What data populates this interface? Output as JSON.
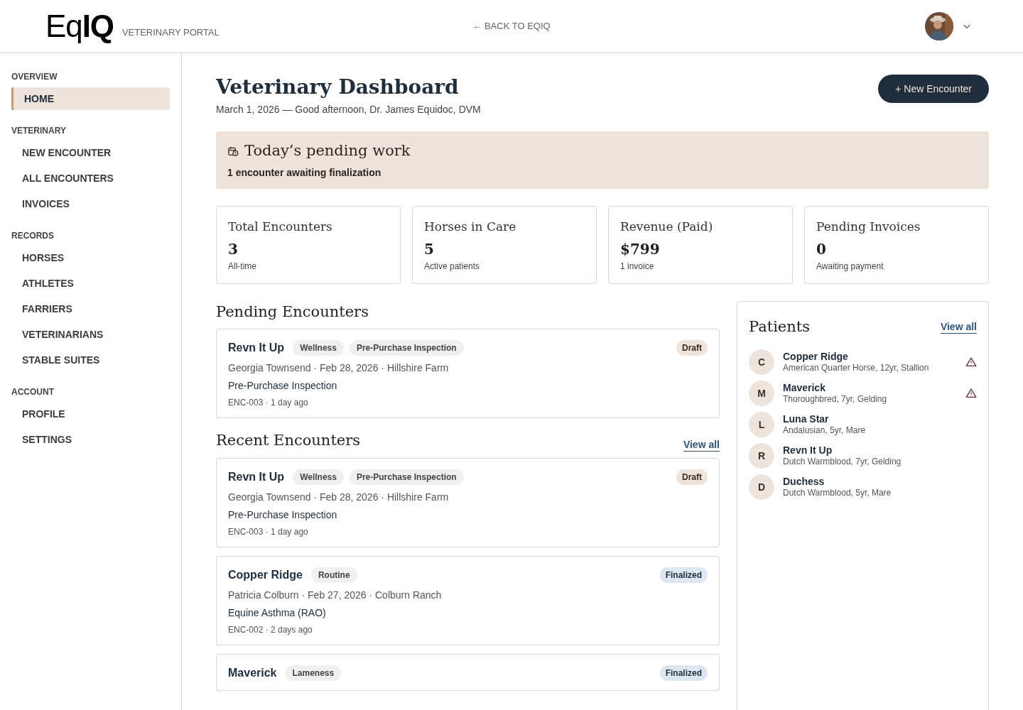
{
  "header": {
    "logo_light": "Eq",
    "logo_bold": "IQ",
    "portal": "VETERINARY PORTAL",
    "back_link": "← BACK TO EQIQ"
  },
  "sidebar": {
    "sections": [
      {
        "title": "OVERVIEW",
        "items": [
          {
            "label": "HOME",
            "selected": true
          }
        ]
      },
      {
        "title": "VETERINARY",
        "items": [
          {
            "label": "NEW ENCOUNTER",
            "selected": false
          },
          {
            "label": "ALL ENCOUNTERS",
            "selected": false
          },
          {
            "label": "INVOICES",
            "selected": false
          }
        ]
      },
      {
        "title": "RECORDS",
        "items": [
          {
            "label": "HORSES",
            "selected": false
          },
          {
            "label": "ATHLETES",
            "selected": false
          },
          {
            "label": "FARRIERS",
            "selected": false
          },
          {
            "label": "VETERINARIANS",
            "selected": false
          },
          {
            "label": "STABLE SUITES",
            "selected": false
          }
        ]
      },
      {
        "title": "ACCOUNT",
        "items": [
          {
            "label": "PROFILE",
            "selected": false
          },
          {
            "label": "SETTINGS",
            "selected": false
          }
        ]
      }
    ]
  },
  "page": {
    "title": "Veterinary Dashboard",
    "subtitle": "March 1, 2026 — Good afternoon, Dr. James Equidoc, DVM",
    "new_button": "+ New Encounter"
  },
  "pending_banner": {
    "title": "Today’s pending work",
    "text": "1 encounter awaiting finalization"
  },
  "stats": [
    {
      "label": "Total Encounters",
      "value": "3",
      "note": "All-time"
    },
    {
      "label": "Horses in Care",
      "value": "5",
      "note": "Active patients"
    },
    {
      "label": "Revenue (Paid)",
      "value": "$799",
      "note": "1 invoice"
    },
    {
      "label": "Pending Invoices",
      "value": "0",
      "note": "Awaiting payment"
    }
  ],
  "pending_encounters": {
    "title": "Pending Encounters",
    "items": [
      {
        "horse": "Revn It Up",
        "tags": [
          "Wellness",
          "Pre-Purchase Inspection"
        ],
        "status": "Draft",
        "kind": "draft",
        "meta": "Georgia Townsend · Feb 28, 2026 · Hillshire Farm",
        "reason": "Pre-Purchase Inspection",
        "ref": "ENC-003 · 1 day ago"
      }
    ]
  },
  "recent_encounters": {
    "title": "Recent Encounters",
    "view_all": "View all",
    "items": [
      {
        "horse": "Revn It Up",
        "tags": [
          "Wellness",
          "Pre-Purchase Inspection"
        ],
        "status": "Draft",
        "kind": "draft",
        "meta": "Georgia Townsend · Feb 28, 2026 · Hillshire Farm",
        "reason": "Pre-Purchase Inspection",
        "ref": "ENC-003 · 1 day ago"
      },
      {
        "horse": "Copper Ridge",
        "tags": [
          "Routine"
        ],
        "status": "Finalized",
        "kind": "finalized",
        "meta": "Patricia Colburn · Feb 27, 2026 · Colburn Ranch",
        "reason": "Equine Asthma (RAO)",
        "ref": "ENC-002 · 2 days ago"
      },
      {
        "horse": "Maverick",
        "tags": [
          "Lameness"
        ],
        "status": "Finalized",
        "kind": "finalized"
      }
    ]
  },
  "patients": {
    "title": "Patients",
    "view_all": "View all",
    "items": [
      {
        "initial": "C",
        "name": "Copper Ridge",
        "details": "American Quarter Horse, 12yr, Stallion",
        "alert": true
      },
      {
        "initial": "M",
        "name": "Maverick",
        "details": "Thoroughbred, 7yr, Gelding",
        "alert": true
      },
      {
        "initial": "L",
        "name": "Luna Star",
        "details": "Andalusian, 5yr, Mare",
        "alert": false
      },
      {
        "initial": "R",
        "name": "Revn It Up",
        "details": "Dutch Warmblood, 7yr, Gelding",
        "alert": false
      },
      {
        "initial": "D",
        "name": "Duchess",
        "details": "Dutch Warmblood, 5yr, Mare",
        "alert": false
      }
    ]
  }
}
